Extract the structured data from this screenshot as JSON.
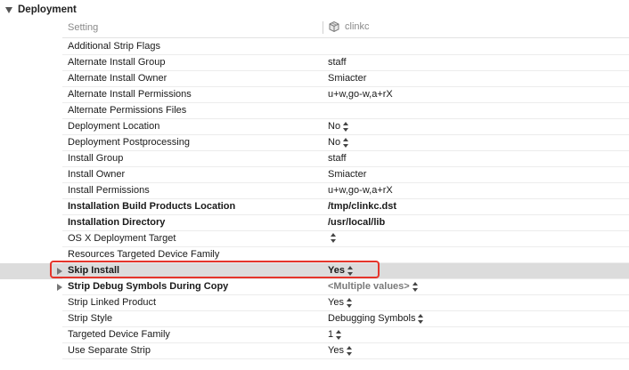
{
  "section": {
    "title": "Deployment"
  },
  "columns": {
    "setting": "Setting",
    "target": "clinkc"
  },
  "rows": [
    {
      "name": "Additional Strip Flags",
      "value": "",
      "bold": false,
      "stepper": false,
      "disclosure": false
    },
    {
      "name": "Alternate Install Group",
      "value": "staff",
      "bold": false,
      "stepper": false,
      "disclosure": false
    },
    {
      "name": "Alternate Install Owner",
      "value": "Smiacter",
      "bold": false,
      "stepper": false,
      "disclosure": false
    },
    {
      "name": "Alternate Install Permissions",
      "value": "u+w,go-w,a+rX",
      "bold": false,
      "stepper": false,
      "disclosure": false
    },
    {
      "name": "Alternate Permissions Files",
      "value": "",
      "bold": false,
      "stepper": false,
      "disclosure": false
    },
    {
      "name": "Deployment Location",
      "value": "No",
      "bold": false,
      "stepper": true,
      "disclosure": false
    },
    {
      "name": "Deployment Postprocessing",
      "value": "No",
      "bold": false,
      "stepper": true,
      "disclosure": false
    },
    {
      "name": "Install Group",
      "value": "staff",
      "bold": false,
      "stepper": false,
      "disclosure": false
    },
    {
      "name": "Install Owner",
      "value": "Smiacter",
      "bold": false,
      "stepper": false,
      "disclosure": false
    },
    {
      "name": "Install Permissions",
      "value": "u+w,go-w,a+rX",
      "bold": false,
      "stepper": false,
      "disclosure": false
    },
    {
      "name": "Installation Build Products Location",
      "value": "/tmp/clinkc.dst",
      "bold": true,
      "stepper": false,
      "disclosure": false
    },
    {
      "name": "Installation Directory",
      "value": "/usr/local/lib",
      "bold": true,
      "stepper": false,
      "disclosure": false
    },
    {
      "name": "OS X Deployment Target",
      "value": "",
      "bold": false,
      "stepper": true,
      "disclosure": false
    },
    {
      "name": "Resources Targeted Device Family",
      "value": "",
      "bold": false,
      "stepper": false,
      "disclosure": false
    },
    {
      "name": "Skip Install",
      "value": "Yes",
      "bold": true,
      "stepper": true,
      "disclosure": true,
      "selected": true
    },
    {
      "name": "Strip Debug Symbols During Copy",
      "value": "<Multiple values>",
      "bold": true,
      "stepper": true,
      "disclosure": true,
      "muted": true
    },
    {
      "name": "Strip Linked Product",
      "value": "Yes",
      "bold": false,
      "stepper": true,
      "disclosure": false
    },
    {
      "name": "Strip Style",
      "value": "Debugging Symbols",
      "bold": false,
      "stepper": true,
      "disclosure": false
    },
    {
      "name": "Targeted Device Family",
      "value": "1",
      "bold": false,
      "stepper": true,
      "disclosure": false
    },
    {
      "name": "Use Separate Strip",
      "value": "Yes",
      "bold": false,
      "stepper": true,
      "disclosure": false
    }
  ]
}
